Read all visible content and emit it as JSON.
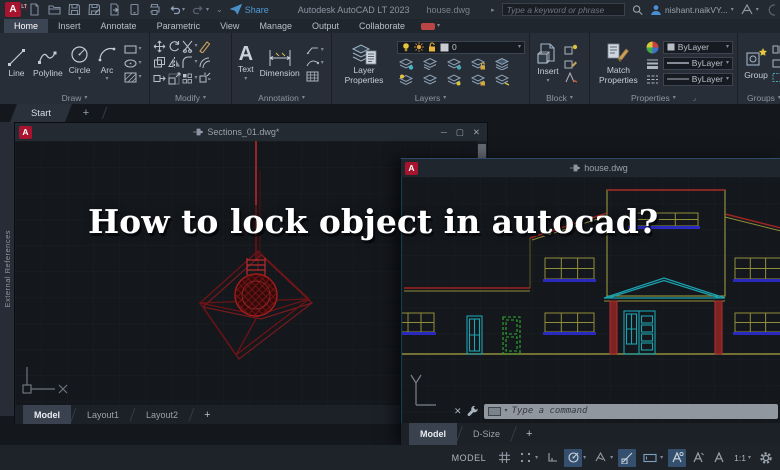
{
  "titlebar": {
    "logo": "A",
    "logo_sub": "LT",
    "share_label": "Share",
    "app_title": "Autodesk AutoCAD LT 2023",
    "doc_title": "house.dwg",
    "search_placeholder": "Type a keyword or phrase",
    "user_name": "nishant.naikVY..."
  },
  "ribbon_tabs": [
    {
      "label": "Home"
    },
    {
      "label": "Insert"
    },
    {
      "label": "Annotate"
    },
    {
      "label": "Parametric"
    },
    {
      "label": "View"
    },
    {
      "label": "Manage"
    },
    {
      "label": "Output"
    },
    {
      "label": "Collaborate"
    }
  ],
  "panels": {
    "draw": {
      "label": "Draw",
      "tools": [
        {
          "label": "Line"
        },
        {
          "label": "Polyline"
        },
        {
          "label": "Circle"
        },
        {
          "label": "Arc"
        }
      ]
    },
    "modify": {
      "label": "Modify"
    },
    "annotation": {
      "label": "Annotation",
      "text_tool": "Text",
      "dimension_tool": "Dimension",
      "text_glyph": "A"
    },
    "layers": {
      "label": "Layers",
      "layer_properties": "Layer Properties",
      "current_layer": "0"
    },
    "block": {
      "label": "Block",
      "insert_tool": "Insert"
    },
    "properties": {
      "label": "Properties",
      "match_tool": "Match Properties",
      "color_value": "ByLayer",
      "lineweight_value": "ByLayer",
      "linetype_value": "ByLayer"
    },
    "groups": {
      "label": "Groups",
      "group_tool": "Group"
    }
  },
  "file_tabs": {
    "start": "Start",
    "new_tab": "+"
  },
  "palette": {
    "external_references": "External References"
  },
  "overlay": {
    "question": "How to lock object in autocad?"
  },
  "window_controls": {
    "minimize": "─",
    "maximize": "▢",
    "close": "✕"
  },
  "sections_window": {
    "badge": "A",
    "title": "Sections_01.dwg*",
    "layout_tabs": [
      {
        "label": "Model"
      },
      {
        "label": "Layout1"
      },
      {
        "label": "Layout2"
      }
    ],
    "add_layout": "+"
  },
  "house_window": {
    "badge": "A",
    "title": "house.dwg",
    "command_placeholder": "Type a command",
    "close_glyph": "✕",
    "layout_tabs": [
      {
        "label": "Model"
      },
      {
        "label": "D-Size"
      }
    ],
    "add_layout": "+"
  },
  "statusbar": {
    "model_label": "MODEL",
    "scale": "1:1"
  },
  "colors": {
    "accent_red": "#a8142e",
    "active_blue": "#35506e",
    "drawing_red": "#a02424",
    "drawing_dark_red": "#6d1315",
    "drawing_cyan": "#1ba3b0",
    "drawing_olive": "#8f8f3a",
    "drawing_blue": "#2a2ac0",
    "drawing_green": "#2fae2f",
    "share_blue": "#4d9bd6"
  }
}
